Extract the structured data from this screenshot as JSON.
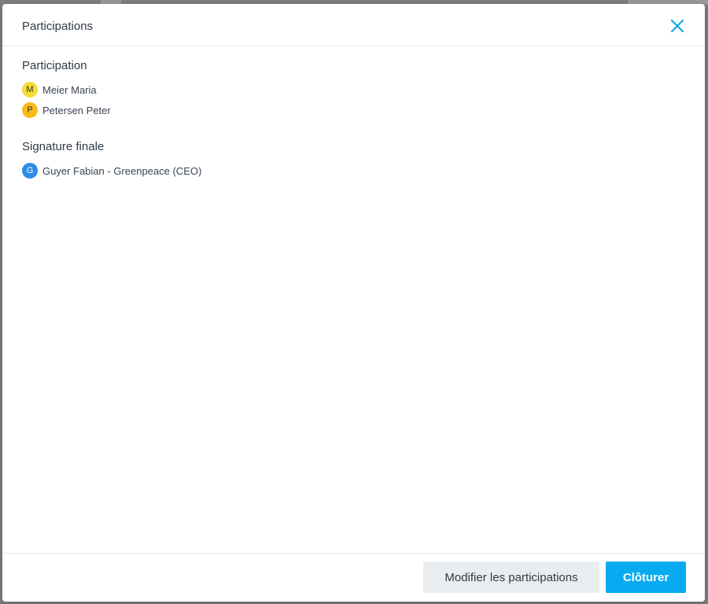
{
  "dialog": {
    "title": "Participations"
  },
  "sections": {
    "participation": {
      "title": "Participation",
      "people": [
        {
          "initial": "M",
          "name": "Meier Maria",
          "color": "#f5dc37"
        },
        {
          "initial": "P",
          "name": "Petersen Peter",
          "color": "#f9b91a"
        }
      ]
    },
    "signature": {
      "title": "Signature finale",
      "people": [
        {
          "initial": "G",
          "name": "Guyer Fabian - Greenpeace (CEO)",
          "color": "#2f8bea"
        }
      ]
    }
  },
  "footer": {
    "modify_label": "Modifier les participations",
    "close_label": "Clôturer"
  },
  "colors": {
    "accent": "#0aaaf0",
    "close_icon": "#14a7ec"
  },
  "icons": {
    "close": "close-icon"
  }
}
